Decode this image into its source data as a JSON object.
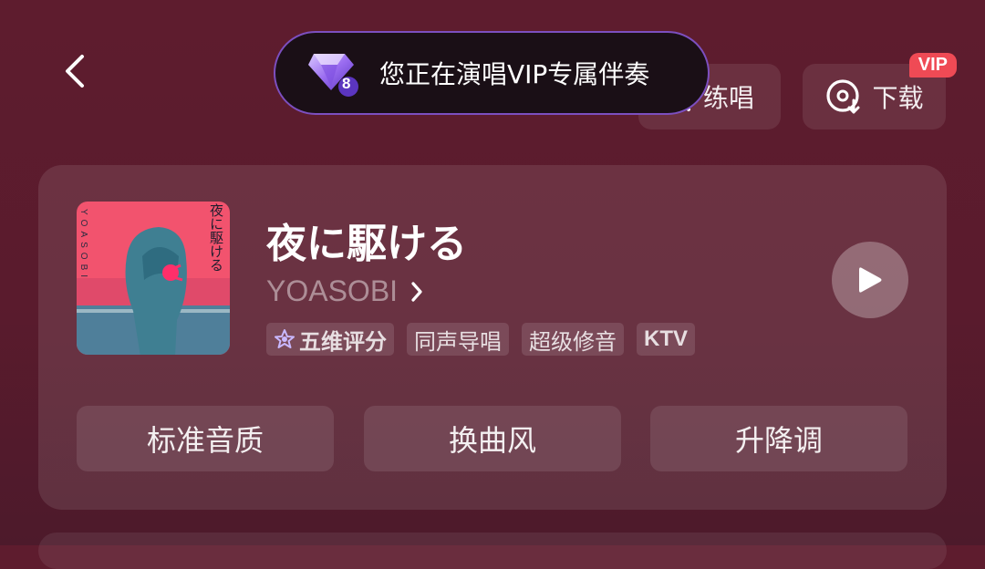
{
  "header": {
    "practice_label": "练唱",
    "download_label": "下载",
    "vip_badge": "VIP"
  },
  "toast": {
    "text": "您正在演唱VIP专属伴奏",
    "level": "8"
  },
  "song": {
    "title": "夜に駆ける",
    "artist": "YOASOBI",
    "cover_side_text": "YOASOBI",
    "cover_title_vertical": "夜に駆ける",
    "tags": [
      "五维评分",
      "同声导唱",
      "超级修音",
      "KTV"
    ]
  },
  "options": {
    "quality": "标准音质",
    "style": "换曲风",
    "pitch": "升降调"
  },
  "icons": {
    "back": "chevron-left-icon",
    "practice": "microphone-icon",
    "download": "disc-download-icon",
    "tag_score": "star-icon",
    "play": "play-icon",
    "toast": "diamond-gem-icon"
  },
  "colors": {
    "background": "#5a1b2d",
    "vip_badge": "#ef4a55",
    "toast_border": "#7c4fbf",
    "cover_pink": "#f2536e"
  }
}
